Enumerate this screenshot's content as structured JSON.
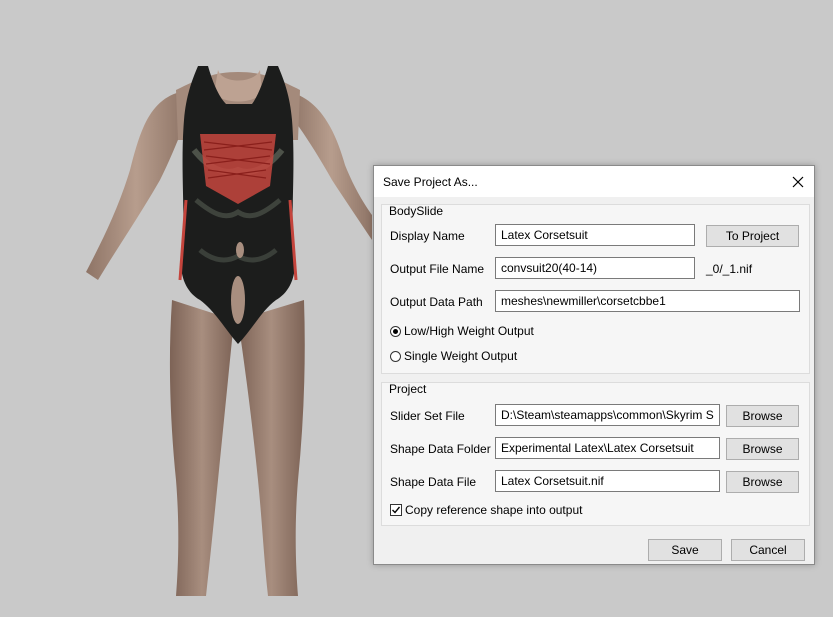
{
  "dialog": {
    "title": "Save Project As...",
    "close_icon": "close-icon"
  },
  "bodyslide": {
    "legend": "BodySlide",
    "display_name_label": "Display Name",
    "display_name_value": "Latex Corsetsuit",
    "to_project_label": "To Project",
    "output_file_label": "Output File Name",
    "output_file_value": "convsuit20(40-14)",
    "output_file_suffix": "_0/_1.nif",
    "output_path_label": "Output Data Path",
    "output_path_value": "meshes\\newmiller\\corsetcbbe1",
    "weight_options": [
      {
        "label": "Low/High Weight Output",
        "selected": true
      },
      {
        "label": "Single Weight Output",
        "selected": false
      }
    ]
  },
  "project": {
    "legend": "Project",
    "slider_set_label": "Slider Set File",
    "slider_set_value": "D:\\Steam\\steamapps\\common\\Skyrim S",
    "shape_folder_label": "Shape Data Folder",
    "shape_folder_value": "Experimental Latex\\Latex Corsetsuit",
    "shape_file_label": "Shape Data File",
    "shape_file_value": "Latex Corsetsuit.nif",
    "browse_label": "Browse",
    "copy_ref_label": "Copy reference shape into output",
    "copy_ref_checked": true
  },
  "footer": {
    "save_label": "Save",
    "cancel_label": "Cancel"
  }
}
